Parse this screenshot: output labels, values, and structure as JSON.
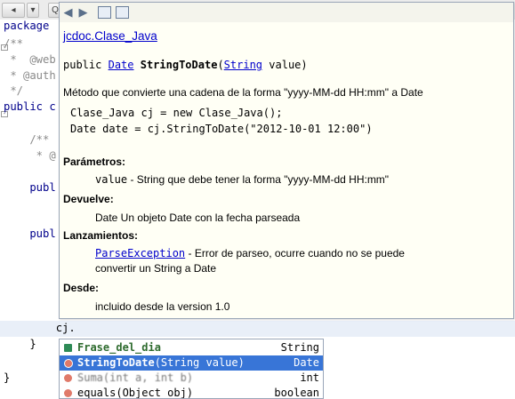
{
  "toolbar": {
    "button_labels": [
      "◂",
      "▾",
      "Q",
      "≡",
      "▸",
      "◂",
      "▸"
    ]
  },
  "code": {
    "lines": [
      {
        "text": "package",
        "cls": "kw"
      },
      {
        "text": "/**",
        "cls": "cm"
      },
      {
        "text": " *  @web",
        "cls": "cm"
      },
      {
        "text": " * @auth",
        "cls": "cm"
      },
      {
        "text": " */",
        "cls": "cm"
      },
      {
        "text": "public c",
        "cls": "kw"
      },
      {
        "text": "",
        "cls": ""
      },
      {
        "text": "    /**",
        "cls": "cm"
      },
      {
        "text": "     * @",
        "cls": "cm"
      },
      {
        "text": "    publ",
        "cls": "kw"
      },
      {
        "text": "",
        "cls": ""
      },
      {
        "text": "",
        "cls": ""
      },
      {
        "text": "    publ",
        "cls": "kw"
      }
    ],
    "current_line": "        cj.",
    "brace_inner": "    }",
    "brace_outer": "}"
  },
  "doc": {
    "title": "jcdoc.Clase_Java",
    "signature_modifier": "public",
    "signature_return": "Date",
    "signature_name": "StringToDate",
    "signature_open": "(",
    "signature_param_type": "String",
    "signature_param": "value)",
    "description": "Método que convierte una cadena de la forma \"yyyy-MM-dd HH:mm\" a Date",
    "example_line1": "Clase_Java cj = new Clase_Java();",
    "example_line2": "Date date = cj.StringToDate(\"2012-10-01 12:00\")",
    "params_heading": "Parámetros:",
    "param_name": "value",
    "param_desc": " - String que debe tener la forma \"yyyy-MM-dd HH:mm\"",
    "returns_heading": "Devuelve:",
    "returns_desc": "Date Un objeto Date con la fecha parseada",
    "throws_heading": "Lanzamientos:",
    "throws_type": "ParseException",
    "throws_desc1": " - Error de parseo, ocurre cuando no se puede",
    "throws_desc2": "convertir un String a Date",
    "since_heading": "Desde:",
    "since_desc": "incluido desde la version 1.0"
  },
  "completion": {
    "items": [
      {
        "name": "Frase_del_dia",
        "args": "",
        "type": "String"
      },
      {
        "name": "StringToDate",
        "args": "(String value)",
        "type": "Date"
      },
      {
        "name": "Suma",
        "args": "(int a, int b)",
        "type": "int"
      },
      {
        "name": "equals",
        "args": "(Object obj)",
        "type": "boolean"
      }
    ]
  },
  "colors": {
    "selection": "#3875d7",
    "link": "#0000cc",
    "field_icon": "#2e8b57",
    "method_icon": "#e07a6a"
  }
}
